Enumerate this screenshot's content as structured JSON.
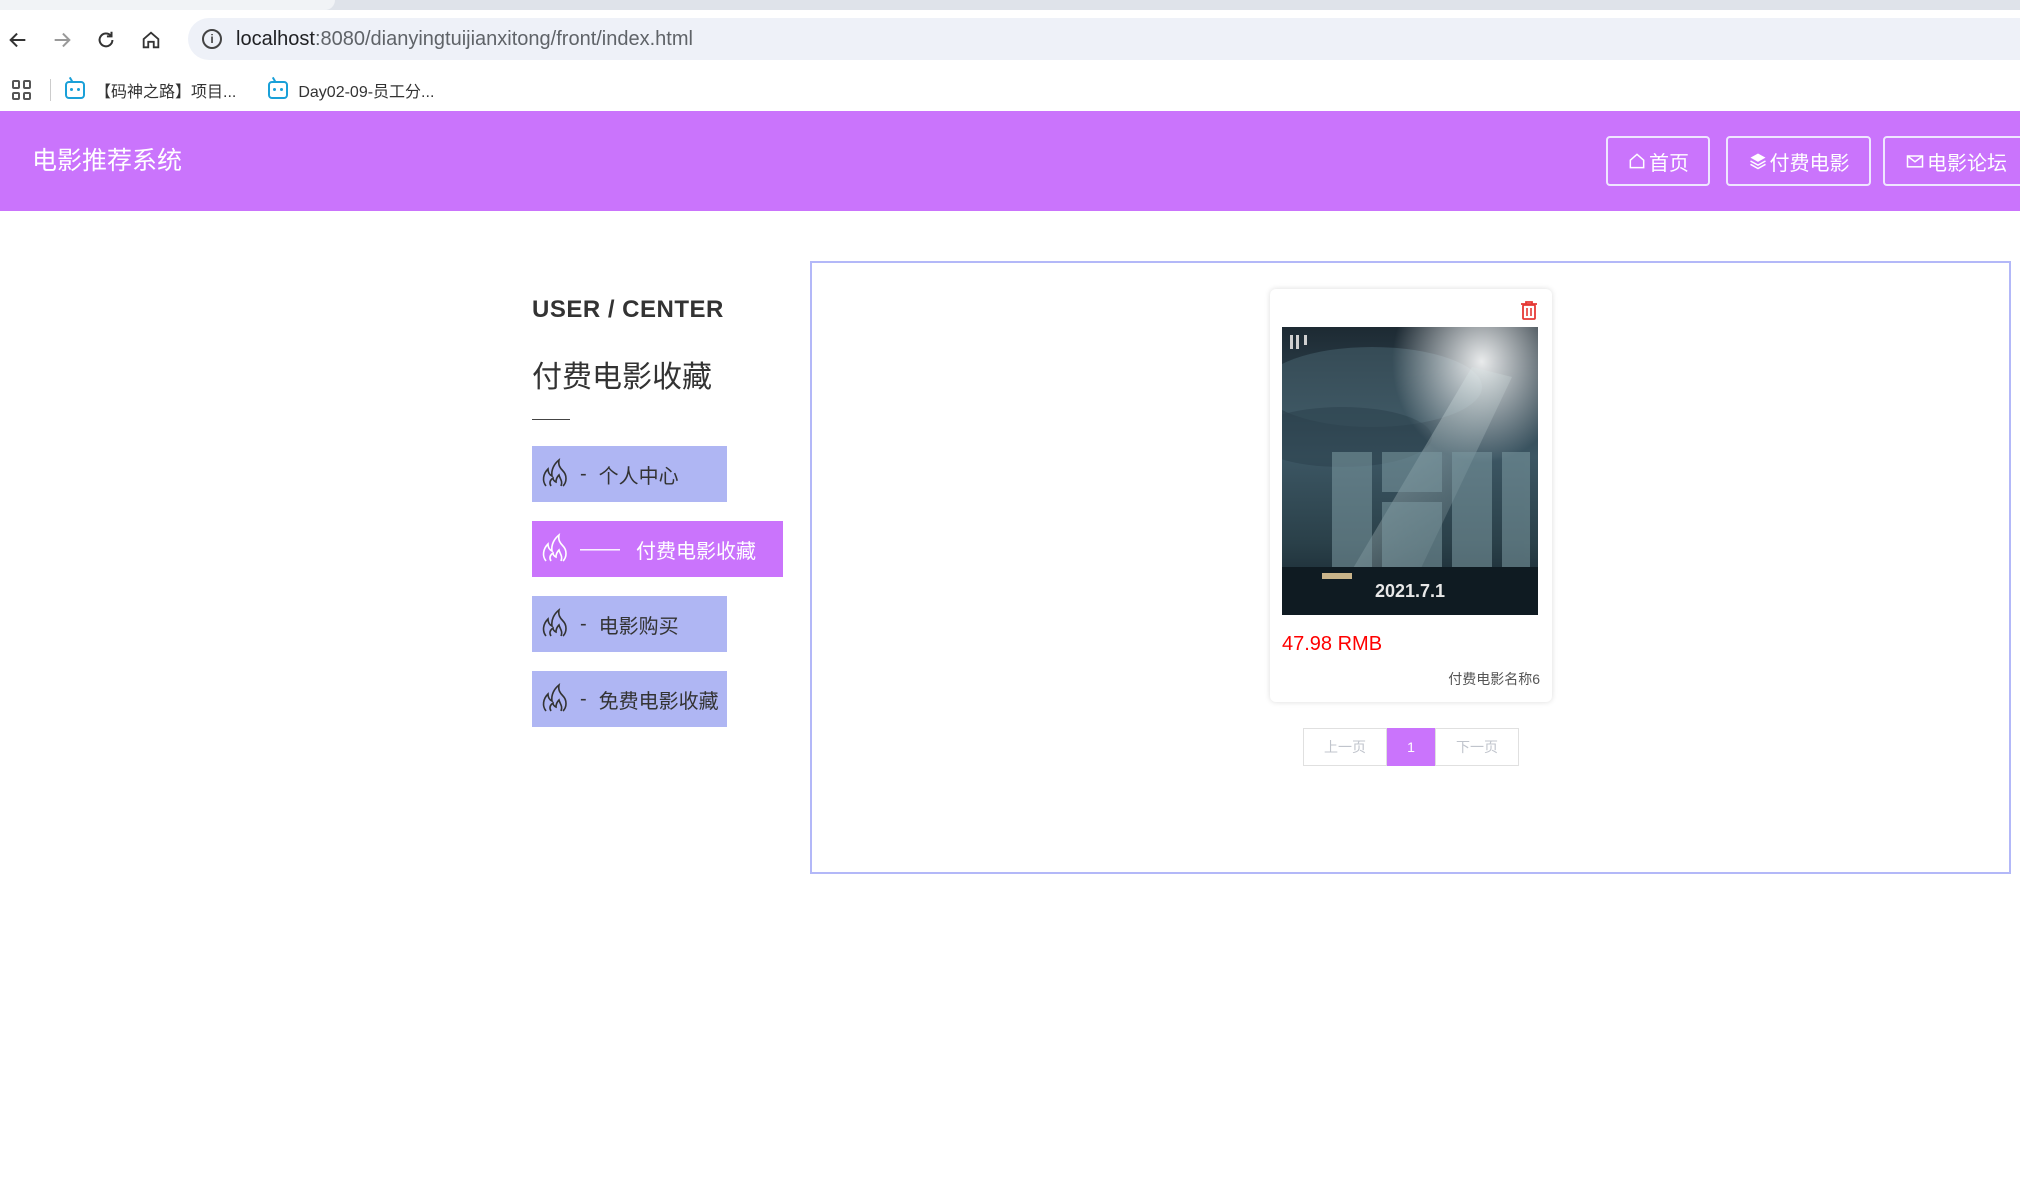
{
  "browser": {
    "url_host": "localhost",
    "url_path": ":8080/dianyingtuijianxitong/front/index.html",
    "bookmarks": [
      {
        "label": "【码神之路】项目..."
      },
      {
        "label": "Day02-09-员工分..."
      }
    ]
  },
  "header": {
    "site_title": "电影推荐系统",
    "nav": [
      {
        "label": "首页",
        "icon": "home-icon"
      },
      {
        "label": "付费电影",
        "icon": "layers-icon"
      },
      {
        "label": "电影论坛",
        "icon": "mail-icon"
      }
    ],
    "color": "#ca74fc"
  },
  "sidebar": {
    "title": "USER / CENTER",
    "subtitle": "付费电影收藏",
    "items": [
      {
        "label": "个人中心",
        "dash": "-",
        "active": false
      },
      {
        "label": "付费电影收藏",
        "dash": "——",
        "active": true
      },
      {
        "label": "电影购买",
        "dash": "-",
        "active": false
      },
      {
        "label": "免费电影收藏",
        "dash": "-",
        "active": false
      }
    ]
  },
  "favorites": {
    "items": [
      {
        "price": "47.98 RMB",
        "name": "付费电影名称6",
        "poster_text": "2021.7.1"
      }
    ]
  },
  "pagination": {
    "prev_label": "上一页",
    "current_page": "1",
    "next_label": "下一页"
  }
}
